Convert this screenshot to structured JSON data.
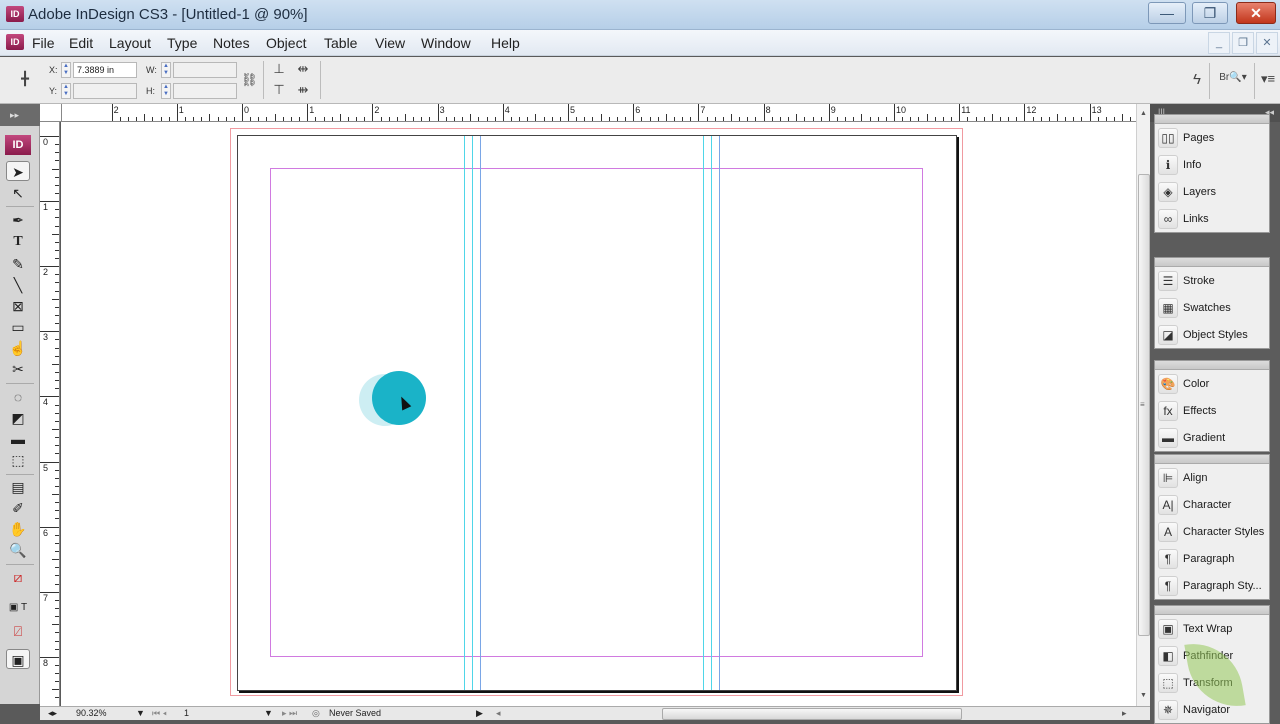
{
  "window": {
    "app_icon": "ID",
    "title": "Adobe InDesign CS3 - [Untitled-1 @ 90%]",
    "controls": {
      "minimize": "—",
      "restore": "❐",
      "close": "✕"
    },
    "doc_controls": {
      "minimize": "_",
      "restore": "❐",
      "close": "✕"
    }
  },
  "menubar": {
    "app_icon": "ID",
    "items": [
      "File",
      "Edit",
      "Layout",
      "Type",
      "Notes",
      "Object",
      "Table",
      "View",
      "Window",
      "Help"
    ]
  },
  "controlbar": {
    "x_label": "X:",
    "x_value": "7.3889 in",
    "y_label": "Y:",
    "y_value": "",
    "w_label": "W:",
    "w_value": "",
    "h_label": "H:",
    "h_value": "",
    "icons": [
      "reference-point-icon",
      "constrain-proportions-icon",
      "distribute-top-icon",
      "distribute-horizontal-icon",
      "distribute-bottom-icon",
      "distribute-space-icon",
      "lightning-icon",
      "bridge-icon",
      "panel-menu-icon"
    ]
  },
  "ruler": {
    "horizontal_labels": [
      "2",
      "1",
      "0",
      "1",
      "2",
      "3",
      "4",
      "5",
      "6",
      "7",
      "8",
      "9",
      "10",
      "11",
      "12",
      "13"
    ],
    "vertical_labels": [
      "0",
      "1",
      "2",
      "3",
      "4",
      "5",
      "6",
      "7",
      "8"
    ]
  },
  "toolbox": {
    "logo": "ID",
    "tools": [
      "selection",
      "direct-selection",
      "pen",
      "type",
      "pencil",
      "line",
      "rectangle-frame",
      "rectangle",
      "button",
      "scissors",
      "free-transform",
      "gradient-swatch",
      "gradient-feather",
      "note",
      "eyedropper",
      "hand",
      "zoom",
      "fill-stroke",
      "apply-color",
      "none",
      "normal-view"
    ]
  },
  "statusbar": {
    "zoom": "90.32%",
    "page": "1",
    "save_status": "Never Saved"
  },
  "panels": {
    "groups": [
      {
        "items": [
          {
            "label": "Pages",
            "icon": "pages-icon"
          },
          {
            "label": "Info",
            "icon": "info-icon"
          },
          {
            "label": "Layers",
            "icon": "layers-icon"
          },
          {
            "label": "Links",
            "icon": "links-icon"
          }
        ]
      },
      {
        "items": [
          {
            "label": "Stroke",
            "icon": "stroke-icon"
          },
          {
            "label": "Swatches",
            "icon": "swatches-icon"
          },
          {
            "label": "Object Styles",
            "icon": "object-styles-icon"
          }
        ]
      },
      {
        "items": [
          {
            "label": "Color",
            "icon": "color-icon"
          },
          {
            "label": "Effects",
            "icon": "effects-icon"
          },
          {
            "label": "Gradient",
            "icon": "gradient-icon"
          }
        ]
      },
      {
        "items": [
          {
            "label": "Align",
            "icon": "align-icon"
          },
          {
            "label": "Character",
            "icon": "character-icon"
          },
          {
            "label": "Character Styles",
            "icon": "character-styles-icon"
          },
          {
            "label": "Paragraph",
            "icon": "paragraph-icon"
          },
          {
            "label": "Paragraph Sty...",
            "icon": "paragraph-styles-icon"
          }
        ]
      },
      {
        "items": [
          {
            "label": "Text Wrap",
            "icon": "text-wrap-icon"
          },
          {
            "label": "Pathfinder",
            "icon": "pathfinder-icon"
          },
          {
            "label": "Transform",
            "icon": "transform-icon"
          },
          {
            "label": "Navigator",
            "icon": "navigator-icon"
          }
        ]
      }
    ]
  },
  "colors": {
    "bleed_guide": "#f09aa0",
    "margin_guide": "#d07ae0",
    "column_guide": "#4fd6e8",
    "cursor_highlight": "#1ab3c8",
    "app_accent": "#a8255f"
  }
}
